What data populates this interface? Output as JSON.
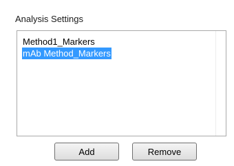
{
  "analysis_settings": {
    "label": "Analysis Settings",
    "items": [
      {
        "label": "Method1_Markers",
        "selected": false
      },
      {
        "label": "mAb Method_Markers",
        "selected": true
      }
    ],
    "add_label": "Add",
    "remove_label": "Remove"
  },
  "colors": {
    "selection": "#3399ff",
    "selection_text": "#ffffff",
    "border": "#a9a9a9"
  }
}
